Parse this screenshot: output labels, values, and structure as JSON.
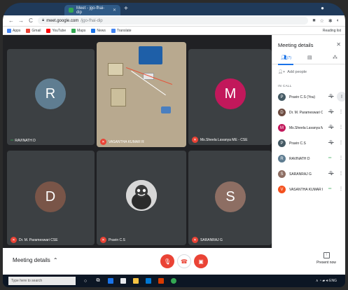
{
  "browser": {
    "tab_title": "Meet - jgo-fhai-dip",
    "new_tab": "+",
    "url_host": "meet.google.com",
    "url_path": "/jgo-fhai-dip",
    "bookmarks": [
      {
        "label": "Apps",
        "color": "#4285f4"
      },
      {
        "label": "Gmail",
        "color": "#ea4335"
      },
      {
        "label": "YouTube",
        "color": "#ff0000"
      },
      {
        "label": "Maps",
        "color": "#34a853"
      },
      {
        "label": "News",
        "color": "#1a73e8"
      },
      {
        "label": "Translate",
        "color": "#4285f4"
      }
    ],
    "reading_list": "Reading list"
  },
  "tiles": [
    {
      "id": "r",
      "initial": "R",
      "name": "RAVINATH D",
      "color": "#5f7d91",
      "status": "speaking"
    },
    {
      "id": "video",
      "name": "VASANTHA KUMAR R",
      "status": "muted"
    },
    {
      "id": "m",
      "initial": "M",
      "name": "Ms.Sheela Lavanya ME - CSE",
      "color": "#c2185b",
      "status": "muted"
    },
    {
      "id": "d",
      "initial": "D",
      "name": "Dr. M. Parameswari CSE",
      "color": "#795548",
      "status": "muted"
    },
    {
      "id": "p",
      "name": "Pravin C.S",
      "status": "muted"
    },
    {
      "id": "s",
      "initial": "S",
      "name": "SARANRAJ G",
      "color": "#8d6e63",
      "status": "muted"
    }
  ],
  "bottom": {
    "meeting_details": "Meeting details",
    "present_now": "Present now"
  },
  "panel": {
    "title": "Meeting details",
    "people_count": "(7)",
    "add_people": "Add people",
    "in_call": "IN CALL",
    "people": [
      {
        "initial": "P",
        "name": "Pravin C.S (You)",
        "color": "#455a64",
        "mic": "muted",
        "pinned": true
      },
      {
        "initial": "D",
        "name": "Dr. M. Parameswari CSE",
        "color": "#6d4c41",
        "mic": "muted"
      },
      {
        "initial": "M",
        "name": "Ms.Sheela Lavanya ME - ...",
        "color": "#c2185b",
        "mic": "muted"
      },
      {
        "initial": "P",
        "name": "Pravin C.S",
        "color": "#455a64",
        "mic": "muted"
      },
      {
        "initial": "R",
        "name": "RAVINATH D",
        "color": "#5f7d91",
        "mic": "speaking"
      },
      {
        "initial": "S",
        "name": "SARANRAJ G",
        "color": "#8d6e63",
        "mic": "muted"
      },
      {
        "initial": "V",
        "name": "VASANTHA KUMAR R",
        "color": "#f4511e",
        "mic": "speaking"
      }
    ]
  },
  "taskbar": {
    "search_placeholder": "Type here to search",
    "tray_label": "ENG"
  },
  "colors": {
    "accent": "#1a73e8",
    "danger": "#ea4335",
    "active_audio": "#34a853"
  }
}
